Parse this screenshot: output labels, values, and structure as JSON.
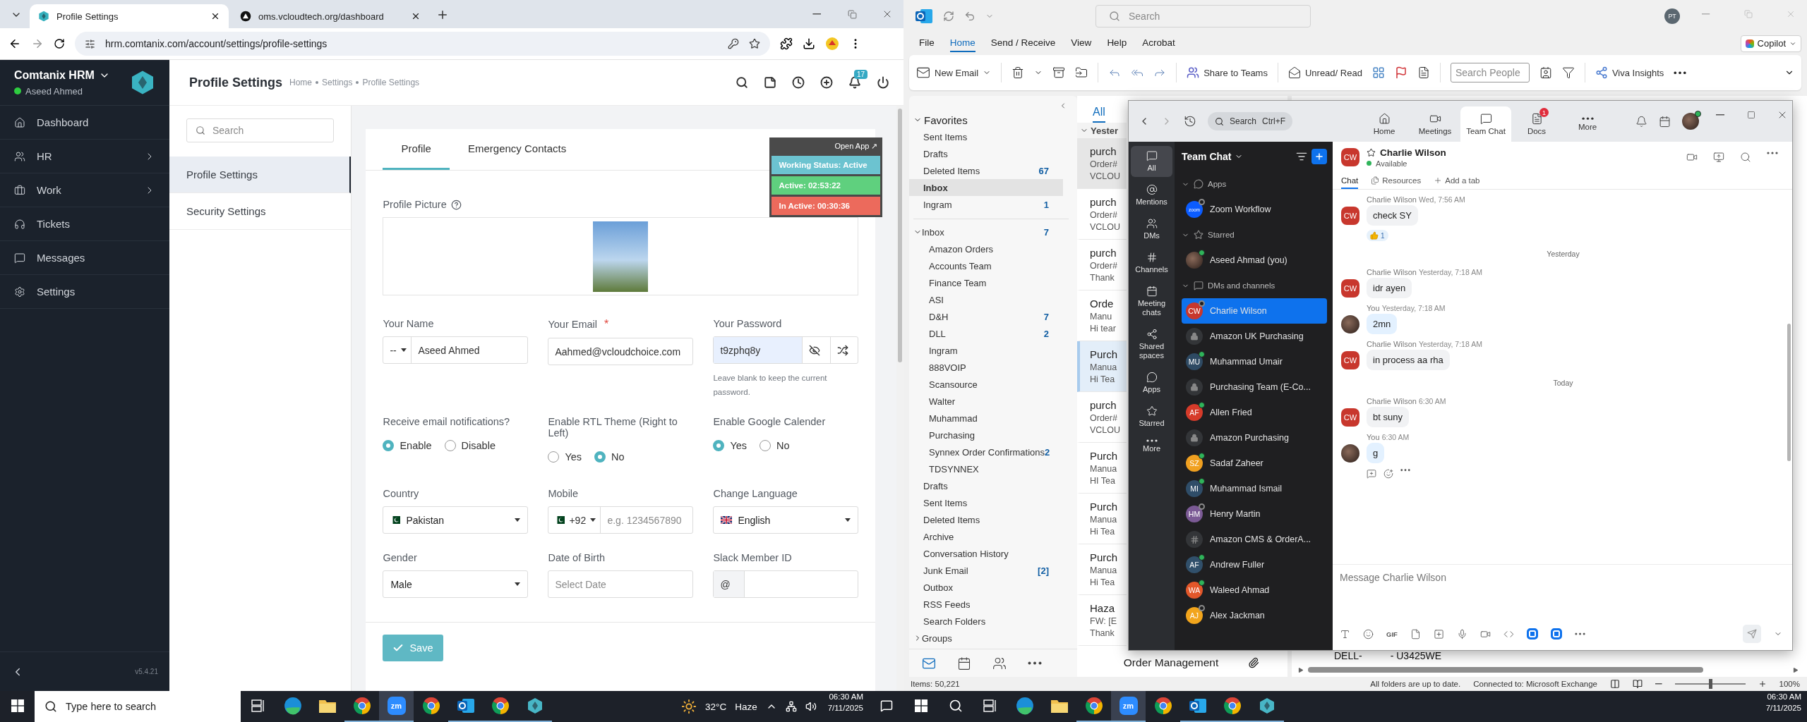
{
  "hrm_browser": {
    "tabs": [
      {
        "title": "Profile Settings",
        "kind": "hexagon",
        "selected": true
      },
      {
        "title": "oms.vcloudtech.org/dashboard",
        "kind": "triangle",
        "selected": false
      }
    ],
    "address": "hrm.comtanix.com/account/settings/profile-settings"
  },
  "hrm": {
    "brand": "Comtanix HRM",
    "user": "Aseed Ahmed",
    "user_online": true,
    "nav": [
      {
        "label": "Dashboard",
        "kind": "home",
        "expandable": false
      },
      {
        "label": "HR",
        "kind": "users",
        "expandable": true
      },
      {
        "label": "Work",
        "kind": "briefcase",
        "expandable": true
      },
      {
        "label": "Tickets",
        "kind": "headphones",
        "expandable": false
      },
      {
        "label": "Messages",
        "kind": "message",
        "expandable": false
      },
      {
        "label": "Settings",
        "kind": "settings",
        "expandable": false
      }
    ],
    "version": "v5.4.21",
    "page_title": "Profile Settings",
    "breadcrumb": [
      "Home",
      "Settings",
      "Profile Settings"
    ],
    "notification_count": "17",
    "menu_search_placeholder": "Search",
    "menu": [
      {
        "label": "Profile Settings",
        "selected": true
      },
      {
        "label": "Security Settings",
        "selected": false
      }
    ],
    "tabs": [
      {
        "label": "Profile",
        "selected": true
      },
      {
        "label": "Emergency Contacts",
        "selected": false
      }
    ],
    "timer": {
      "open_app": "Open App ↗",
      "working_status": "Working Status: Active",
      "active": "Active: 02:53:22",
      "inactive": "In Active: 00:30:36"
    },
    "picture_label": "Profile Picture",
    "name": {
      "label": "Your Name",
      "title": "--",
      "value": "Aseed Ahmed"
    },
    "email": {
      "label": "Your Email",
      "required_mark": "*",
      "value": "Aahmed@vcloudchoice.com"
    },
    "password": {
      "label": "Your Password",
      "value": "t9zphq8y",
      "hint": "Leave blank to keep the current password."
    },
    "radio_groups": [
      {
        "label": "Receive email notifications?",
        "options": [
          {
            "label": "Enable",
            "selected": true
          },
          {
            "label": "Disable",
            "selected": false
          }
        ]
      },
      {
        "label": "Enable RTL Theme (Right to Left)",
        "options": [
          {
            "label": "Yes",
            "selected": false
          },
          {
            "label": "No",
            "selected": true
          }
        ]
      },
      {
        "label": "Enable Google Calender",
        "options": [
          {
            "label": "Yes",
            "selected": true
          },
          {
            "label": "No",
            "selected": false
          }
        ]
      }
    ],
    "country": {
      "label": "Country",
      "value": "Pakistan"
    },
    "mobile": {
      "label": "Mobile",
      "code": "+92",
      "placeholder": "e.g. 1234567890"
    },
    "language": {
      "label": "Change Language",
      "value": "English"
    },
    "gender": {
      "label": "Gender",
      "value": "Male"
    },
    "birth": {
      "label": "Date of Birth",
      "placeholder": "Select Date"
    },
    "slack": {
      "label": "Slack Member ID",
      "prefix": "@"
    },
    "save": "Save"
  },
  "left_taskbar": {
    "search_placeholder": "Type here to search",
    "zoom_label": "zm",
    "temperature": "32°C",
    "weather": "Haze",
    "time": "06:30 AM",
    "date": "7/11/2025"
  },
  "outlook": {
    "search_placeholder": "Search",
    "avatar": "PT",
    "menu": [
      {
        "label": "File",
        "selected": false
      },
      {
        "label": "Home",
        "selected": true
      },
      {
        "label": "Send / Receive",
        "selected": false
      },
      {
        "label": "View",
        "selected": false
      },
      {
        "label": "Help",
        "selected": false
      },
      {
        "label": "Acrobat",
        "selected": false
      }
    ],
    "copilot": "Copilot",
    "new_email": "New Email",
    "share_teams": "Share to Teams",
    "unread": "Unread/ Read",
    "people_placeholder": "Search People",
    "viva": "Viva Insights",
    "favorites_title": "Favorites",
    "favorites": [
      {
        "label": "Sent Items",
        "selected": false
      },
      {
        "label": "Drafts",
        "selected": false
      },
      {
        "label": "Deleted Items",
        "count": "67",
        "selected": false
      },
      {
        "label": "Inbox",
        "selected": true
      },
      {
        "label": "Ingram",
        "count": "1",
        "selected": false
      }
    ],
    "inbox": {
      "label": "Inbox",
      "count": "7",
      "expanded": true,
      "children": [
        {
          "label": "Amazon Orders"
        },
        {
          "label": "Accounts Team"
        },
        {
          "label": "Finance Team"
        },
        {
          "label": "ASI"
        },
        {
          "label": "D&H",
          "count": "7"
        },
        {
          "label": "DLL",
          "count": "2"
        },
        {
          "label": "Ingram"
        },
        {
          "label": "888VOIP"
        },
        {
          "label": "Scansource"
        },
        {
          "label": "Walter"
        },
        {
          "label": "Muhammad"
        },
        {
          "label": "Purchasing"
        },
        {
          "label": "Synnex Order Confirmations",
          "count": "2"
        },
        {
          "label": "TDSYNNEX"
        }
      ]
    },
    "folders": [
      {
        "label": "Drafts"
      },
      {
        "label": "Sent Items"
      },
      {
        "label": "Deleted Items"
      },
      {
        "label": "Archive"
      },
      {
        "label": "Conversation History"
      },
      {
        "label": "Junk Email",
        "count": "[2]"
      },
      {
        "label": "Outbox"
      },
      {
        "label": "RSS Feeds"
      },
      {
        "label": "Search Folders"
      }
    ],
    "groups": "Groups",
    "list_filter": "All",
    "list_group": "Yester",
    "messages": [
      {
        "line1": "purch",
        "line2": "Order#",
        "line3": "VCLOU",
        "hovered": true,
        "selected": false
      },
      {
        "line1": "purch",
        "line2": "Order#",
        "line3": "VCLOU",
        "hovered": false,
        "selected": false
      },
      {
        "line1": "purch",
        "line2": "Order#",
        "line3": "Thank",
        "hovered": false,
        "selected": false
      },
      {
        "line1": "Orde",
        "line2": "Manu",
        "line3": "Hi tear",
        "hovered": false,
        "selected": false
      },
      {
        "line1": "Purch",
        "line2": "Manua",
        "line3": "Hi Tea",
        "hovered": false,
        "selected": true
      },
      {
        "line1": "purch",
        "line2": "Order#",
        "line3": "VCLOU",
        "hovered": false,
        "selected": false
      },
      {
        "line1": "Purch",
        "line2": "Manua",
        "line3": "HI Tea",
        "hovered": false,
        "selected": false
      },
      {
        "line1": "Purch",
        "line2": "Manua",
        "line3": "Hi Tea",
        "hovered": false,
        "selected": false
      },
      {
        "line1": "Purch",
        "line2": "Manua",
        "line3": "Hi Tea",
        "hovered": false,
        "selected": false
      },
      {
        "line1": "Haza",
        "line2": "FW: [E",
        "line3": "Thank",
        "hovered": false,
        "selected": false
      }
    ],
    "last_message": "Order Management",
    "reading_text": [
      "DELL-",
      "- U3425WE"
    ],
    "status_items": "Items: 50,221",
    "status_sync": "All folders are up to date.",
    "status_connection": "Connected to: Microsoft Exchange",
    "zoom_slider": {
      "level": 0.5
    },
    "zoom_reading": "100%"
  },
  "zoom": {
    "search": "Search",
    "search_shortcut": "Ctrl+F",
    "nav": [
      {
        "label": "Home",
        "kind": "home",
        "selected": false
      },
      {
        "label": "Meetings",
        "kind": "video",
        "selected": false
      },
      {
        "label": "Team Chat",
        "kind": "chat",
        "selected": true
      },
      {
        "label": "Docs",
        "kind": "doc",
        "badge": "1",
        "selected": false
      },
      {
        "label": "More",
        "kind": "more",
        "selected": false
      }
    ],
    "rail": [
      {
        "label": "All",
        "kind": "chat",
        "selected": true
      },
      {
        "label": "Mentions",
        "kind": "at",
        "selected": false
      },
      {
        "label": "DMs",
        "kind": "people",
        "selected": false
      },
      {
        "label": "Channels",
        "kind": "hash",
        "selected": false
      },
      {
        "label": "Meeting chats",
        "kind": "calendar",
        "selected": false
      },
      {
        "label": "Shared spaces",
        "kind": "share",
        "selected": false
      },
      {
        "label": "Apps",
        "kind": "apps",
        "selected": false
      },
      {
        "label": "Starred",
        "kind": "star",
        "selected": false
      },
      {
        "label": "More",
        "kind": "more",
        "selected": false
      }
    ],
    "list_title": "Team Chat",
    "sections": [
      {
        "title": "Apps",
        "kind": "apps",
        "items": [
          {
            "name": "Zoom Workflow",
            "kind": "app",
            "logo": "zoom",
            "online": false,
            "selected": false
          }
        ]
      },
      {
        "title": "Starred",
        "kind": "star",
        "items": [
          {
            "name": "Aseed Ahmad (you)",
            "kind": "photo",
            "online": true,
            "selected": false
          }
        ]
      },
      {
        "title": "DMs and channels",
        "kind": "chat",
        "items": [
          {
            "name": "Charlie Wilson",
            "kind": "initials",
            "initials": "CW",
            "color": "#c8372d",
            "online": false,
            "selected": true
          },
          {
            "name": "Amazon UK Purchasing",
            "kind": "lock",
            "selected": false
          },
          {
            "name": "Muhammad Umair",
            "kind": "initials",
            "initials": "MU",
            "color": "#2e4a63",
            "online": true,
            "selected": false
          },
          {
            "name": "Purchasing Team (E-Co...",
            "kind": "lock",
            "selected": false
          },
          {
            "name": "Allen Fried",
            "kind": "initials",
            "initials": "AF",
            "color": "#d63b2a",
            "online": true,
            "selected": false
          },
          {
            "name": "Amazon Purchasing",
            "kind": "lock",
            "selected": false
          },
          {
            "name": "Sadaf Zaheer",
            "kind": "initials",
            "initials": "SZ",
            "color": "#f0a020",
            "online": true,
            "selected": false
          },
          {
            "name": "Muhammad Ismail",
            "kind": "initials",
            "initials": "MI",
            "color": "#2f4d68",
            "online": true,
            "selected": false
          },
          {
            "name": "Henry Martin",
            "kind": "initials",
            "initials": "HM",
            "color": "#7b5a95",
            "online": false,
            "selected": false
          },
          {
            "name": "Amazon CMS & OrderA...",
            "kind": "hash",
            "selected": false
          },
          {
            "name": "Andrew Fuller",
            "kind": "initials",
            "initials": "AF",
            "color": "#31506b",
            "online": true,
            "selected": false
          },
          {
            "name": "Waleed Ahmad",
            "kind": "initials",
            "initials": "WA",
            "color": "#e2572a",
            "online": true,
            "selected": false
          },
          {
            "name": "Alex Jackman",
            "kind": "initials",
            "initials": "AJ",
            "color": "#f2a51c",
            "online": false,
            "selected": false
          }
        ]
      }
    ],
    "chat": {
      "contact": "Charlie Wilson",
      "initials": "CW",
      "status": "Available",
      "tabs": [
        {
          "label": "Chat",
          "kind": "chat",
          "selected": true
        },
        {
          "label": "Resources",
          "kind": "files",
          "selected": false
        },
        {
          "label": "Add a tab",
          "kind": "add",
          "selected": false
        }
      ],
      "messages": [
        {
          "kind": "message",
          "sender": "Charlie Wilson",
          "time": "Wed, 7:56 AM",
          "text": "check SY",
          "mine": false,
          "initials": "CW",
          "reaction_count": "1"
        },
        {
          "kind": "divider",
          "text": "Yesterday"
        },
        {
          "kind": "message",
          "sender": "Charlie Wilson",
          "time": "Yesterday, 7:18 AM",
          "text": "idr ayen",
          "mine": false,
          "initials": "CW"
        },
        {
          "kind": "message",
          "sender": "You",
          "time": "Yesterday, 7:18 AM",
          "text": "2mn",
          "mine": true
        },
        {
          "kind": "message",
          "sender": "Charlie Wilson",
          "time": "Yesterday, 7:18 AM",
          "text": "in process aa rha",
          "mine": false,
          "initials": "CW"
        },
        {
          "kind": "divider",
          "text": "Today"
        },
        {
          "kind": "message",
          "sender": "Charlie Wilson",
          "time": "6:30 AM",
          "text": "bt suny",
          "mine": false,
          "initials": "CW"
        },
        {
          "kind": "message",
          "sender": "You",
          "time": "6:30 AM",
          "text": "g",
          "mine": true,
          "actions": true
        }
      ],
      "composer_placeholder": "Message Charlie Wilson",
      "gif": "GIF"
    }
  },
  "right_taskbar": {
    "zoom_label": "zm",
    "time": "06:30 AM",
    "date": "7/11/2025"
  }
}
